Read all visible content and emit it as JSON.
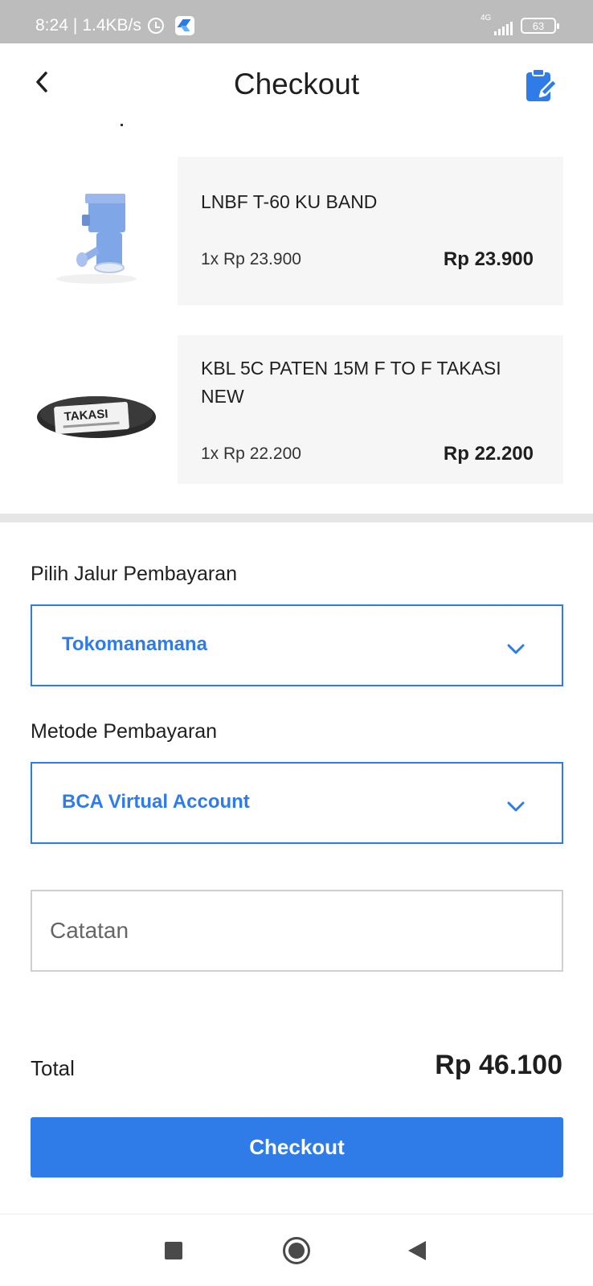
{
  "status_bar": {
    "time": "8:24",
    "separator": "|",
    "network_speed": "1.4KB/s",
    "network_type": "4G",
    "battery_level": "63",
    "icons": [
      "alarm-icon",
      "app-notification-icon",
      "signal-icon",
      "battery-icon"
    ]
  },
  "header": {
    "title": "Checkout",
    "back_icon": "chevron-left-icon",
    "action_icon": "edit-clipboard-icon"
  },
  "items": [
    {
      "name": "LNBF T-60 KU BAND",
      "quantity_price": "1x Rp 23.900",
      "subtotal": "Rp 23.900",
      "image_icon": "lnbf-product-image"
    },
    {
      "name": "KBL 5C PATEN 15M F TO F TAKASI NEW",
      "quantity_price": "1x Rp 22.200",
      "subtotal": "Rp 22.200",
      "image_icon": "cable-product-image",
      "image_label": "TAKASI"
    }
  ],
  "payment_channel": {
    "label": "Pilih Jalur Pembayaran",
    "selected": "Tokomanamana"
  },
  "payment_method": {
    "label": "Metode Pembayaran",
    "selected": "BCA Virtual Account"
  },
  "notes": {
    "placeholder": "Catatan",
    "value": ""
  },
  "summary": {
    "total_label": "Total",
    "total_value": "Rp 46.100"
  },
  "actions": {
    "checkout_label": "Checkout"
  },
  "colors": {
    "accent": "#2f7ce9",
    "status_bar": "#bcbcbc",
    "card_bg": "#f6f6f6",
    "divider": "#e6e6e6"
  }
}
